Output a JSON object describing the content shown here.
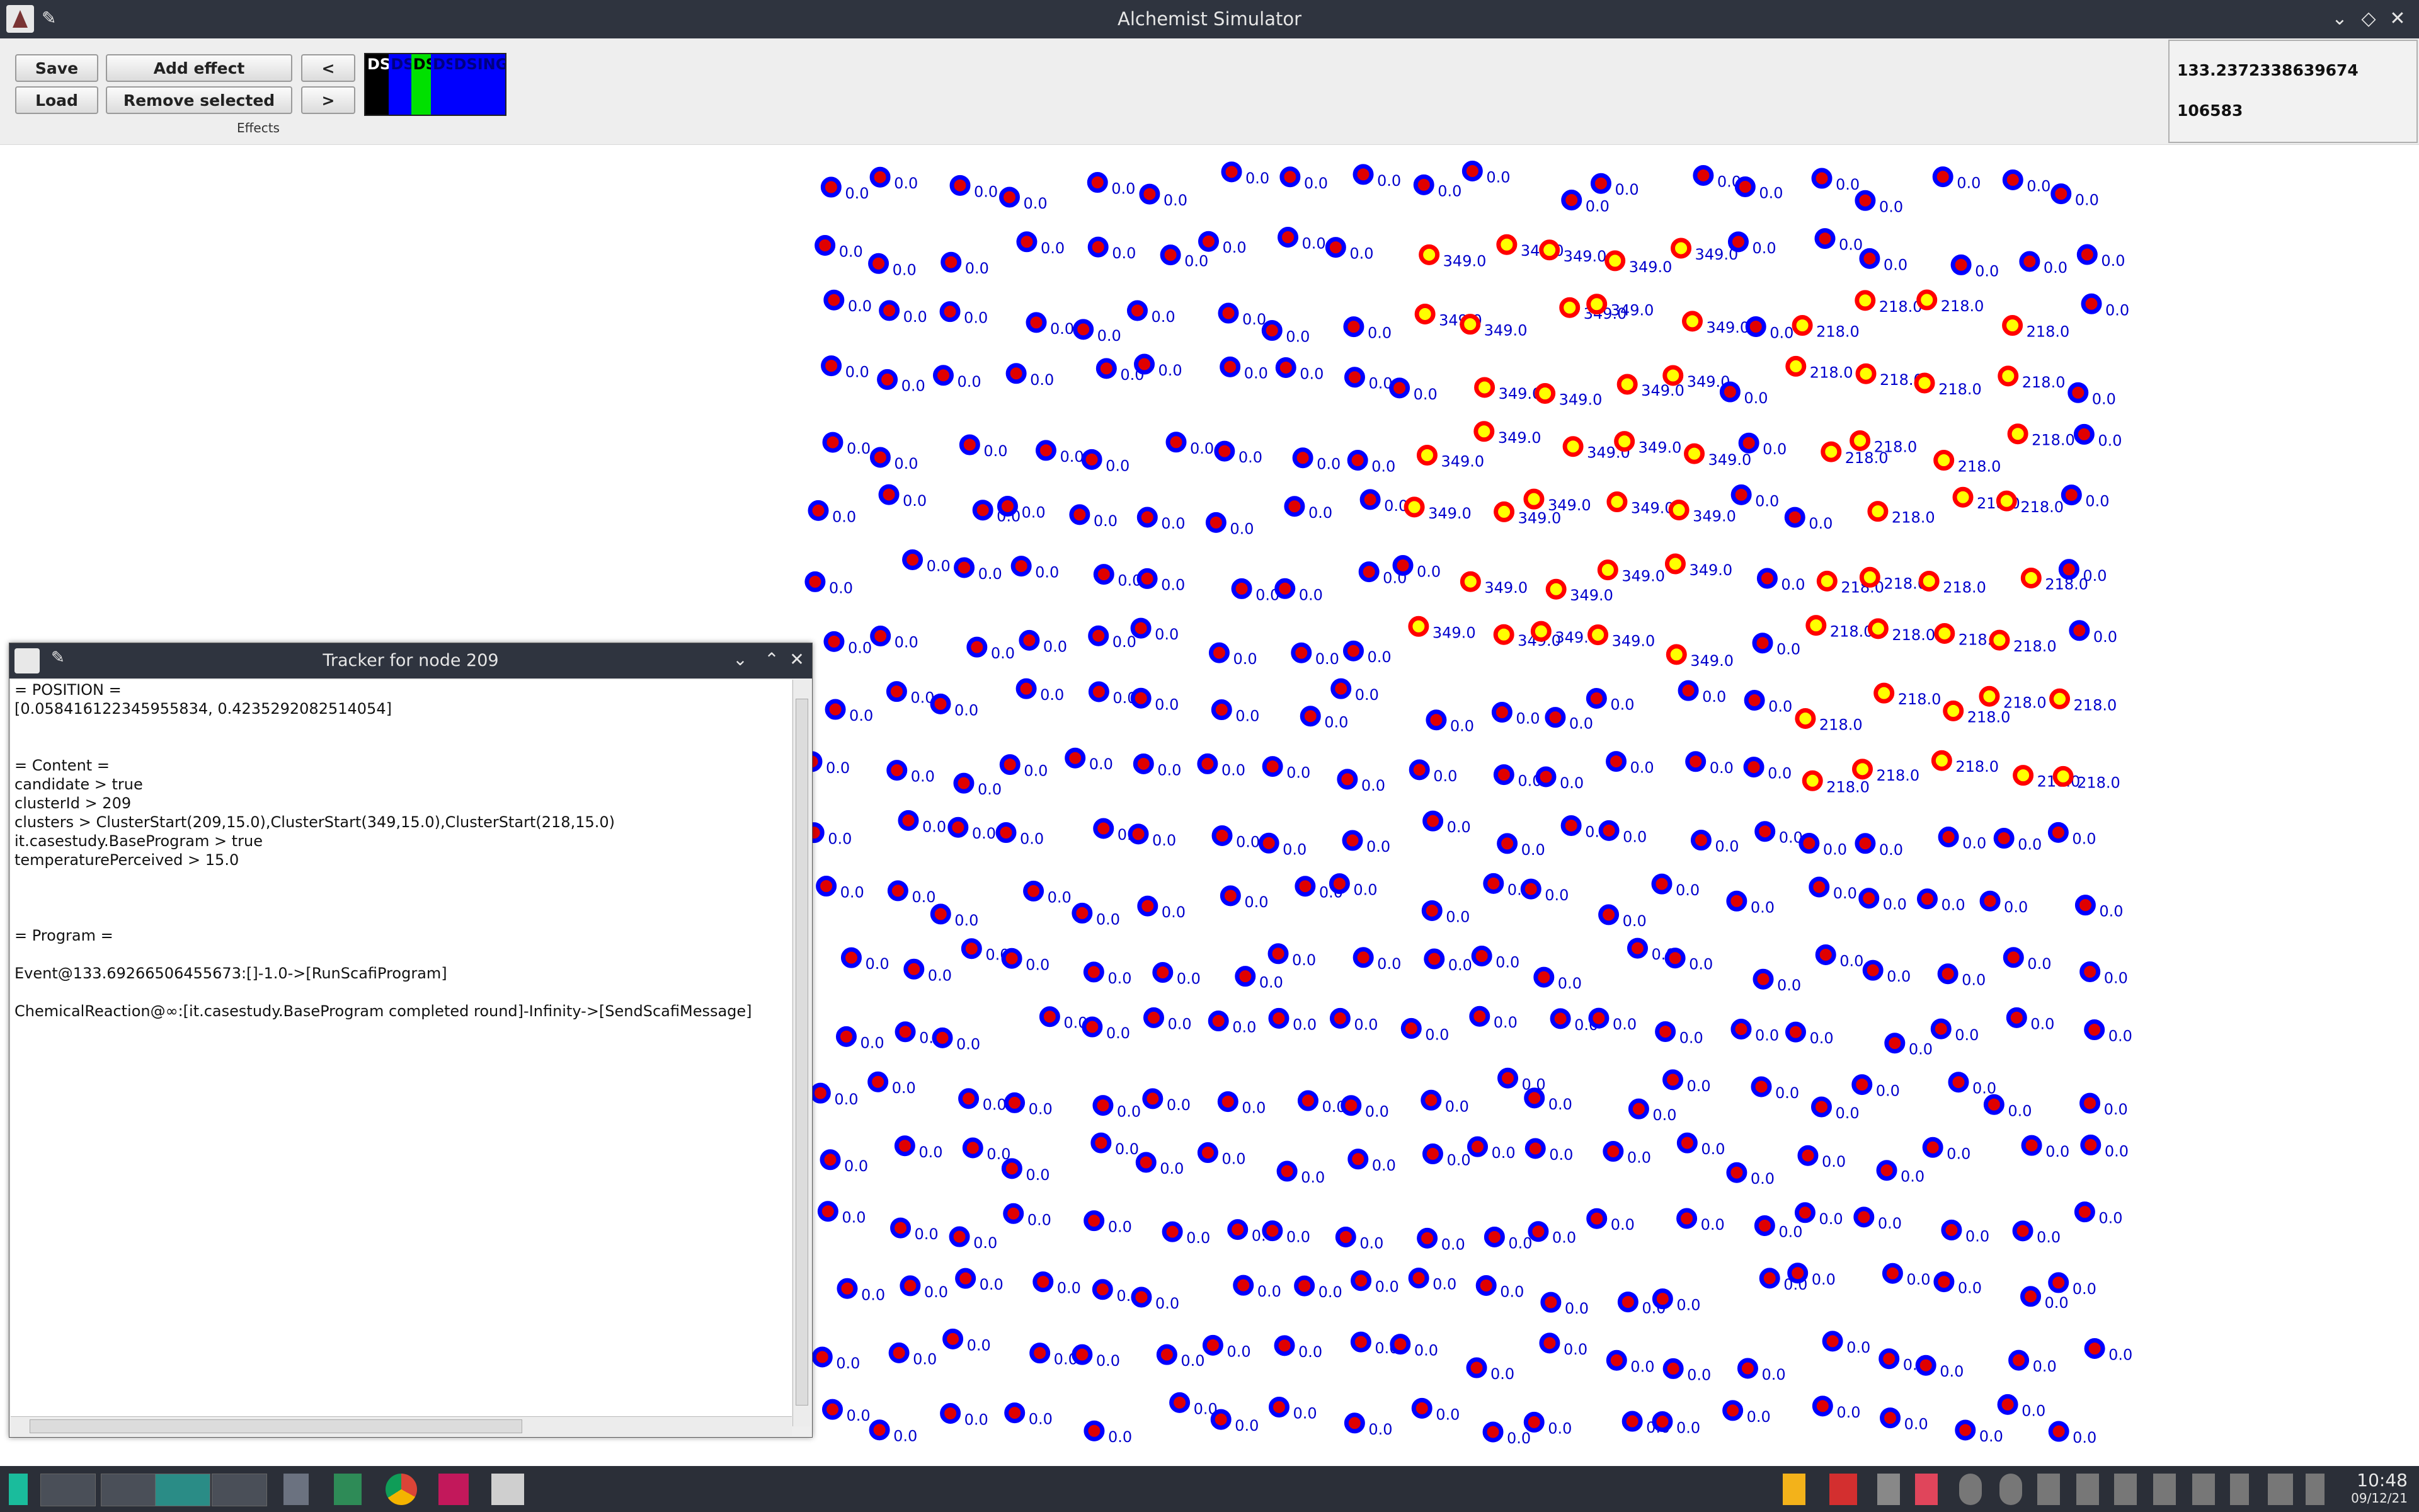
{
  "window": {
    "title": "Alchemist Simulator"
  },
  "toolbar": {
    "save_label": "Save",
    "load_label": "Load",
    "add_effect_label": "Add effect",
    "remove_selected_label": "Remove selected",
    "prev_label": "<",
    "next_label": ">",
    "effects_group_label": "Effects",
    "effect_chips": [
      {
        "label": "DS",
        "color": "#000000",
        "text_color": "#ffffff"
      },
      {
        "label": "DS",
        "color": "#0000ff",
        "text_color": "#000080"
      },
      {
        "label": "DS",
        "color": "#00e000",
        "text_color": "#000000"
      },
      {
        "label": "DS",
        "color": "#0000ff",
        "text_color": "#000080"
      },
      {
        "label": "DSINGLE",
        "color": "#0000ff",
        "text_color": "#000080"
      }
    ]
  },
  "status": {
    "time": "133.2372338639674",
    "steps": "106583"
  },
  "tracker": {
    "title": "Tracker for node 209",
    "lines": [
      "= POSITION =",
      "[0.0584161223459558​34, 0.4235292082514054]",
      "",
      "",
      "= Content =",
      "candidate > true",
      "clusterId > 209",
      "clusters > ClusterStart(209,15.0),ClusterStart(349,15.0),ClusterStart(218,15.0)",
      "it.casestudy.BaseProgram > true",
      "temperaturePerceived > 15.0",
      "",
      "",
      "",
      "= Program =",
      "",
      "Event@133.69266506455673:[]-1.0->[RunScafiProgram]",
      "",
      "ChemicalReaction@∞:[it.casestudy.BaseProgram completed round]-Infinity->[SendScafiMessage]"
    ]
  },
  "nodes_legend": {
    "normal_fill": "#e00000",
    "normal_ring": "#0000ff",
    "cluster_fill": "#ffff00",
    "cluster_ring": "#ff0000",
    "label_color": "#0000cc"
  },
  "taskbar": {
    "time": "10:48",
    "date": "09/12/21"
  }
}
